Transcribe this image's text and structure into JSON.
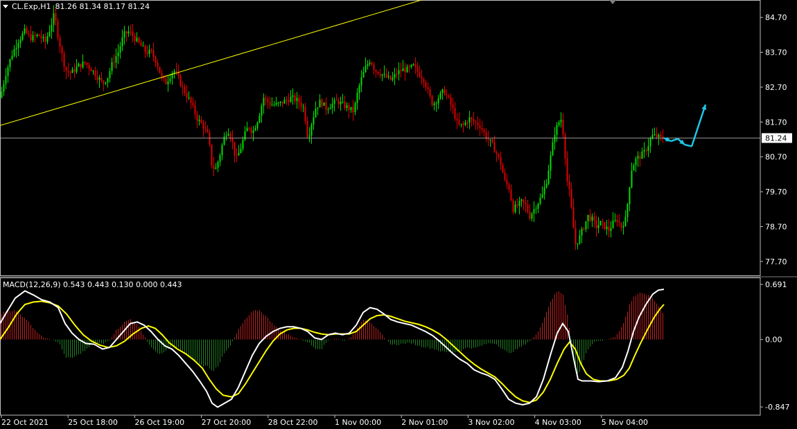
{
  "header": {
    "symbol": "CL.Exp,H1",
    "open": "81.26",
    "high": "81.34",
    "low": "81.17",
    "close": "81.24"
  },
  "macd_header": {
    "label": "MACD(12,26,9)",
    "values": "0.543 0.443 0.130 0.000 0.443"
  },
  "colors": {
    "background": "#000000",
    "bull": "#00e000",
    "bear": "#e00000",
    "trendline": "#ffff00",
    "price_line": "#c8c8c8",
    "forecast": "#1ec8e6",
    "macd_line": "#ffffff",
    "signal_line": "#ffff00",
    "hist_pos": "#c02020",
    "hist_neg": "#208020"
  },
  "chart_data": [
    {
      "type": "candlestick",
      "title": "CL.Exp,H1",
      "y_ticks": [
        "84.70",
        "83.70",
        "82.70",
        "81.70",
        "80.70",
        "79.70",
        "78.70",
        "77.70"
      ],
      "ylim": [
        77.3,
        85.2
      ],
      "current_price": "81.24",
      "x_ticks": [
        "22 Oct 2021",
        "25 Oct 18:00",
        "26 Oct 19:00",
        "27 Oct 20:00",
        "28 Oct 22:00",
        "1 Nov 00:00",
        "2 Nov 01:00",
        "3 Nov 02:00",
        "4 Nov 03:00",
        "5 Nov 04:00"
      ],
      "close_path": [
        [
          0,
          82.4
        ],
        [
          8,
          83.1
        ],
        [
          16,
          83.6
        ],
        [
          25,
          84.0
        ],
        [
          35,
          84.3
        ],
        [
          45,
          84.1
        ],
        [
          55,
          84.2
        ],
        [
          65,
          84.0
        ],
        [
          72,
          84.4
        ],
        [
          78,
          84.8
        ],
        [
          83,
          84.2
        ],
        [
          88,
          83.7
        ],
        [
          94,
          83.2
        ],
        [
          102,
          83.1
        ],
        [
          112,
          83.3
        ],
        [
          122,
          83.4
        ],
        [
          132,
          83.2
        ],
        [
          140,
          83.0
        ],
        [
          148,
          82.8
        ],
        [
          155,
          83.0
        ],
        [
          162,
          83.4
        ],
        [
          170,
          83.7
        ],
        [
          178,
          84.2
        ],
        [
          186,
          84.3
        ],
        [
          194,
          84.1
        ],
        [
          202,
          83.9
        ],
        [
          210,
          83.7
        ],
        [
          218,
          83.7
        ],
        [
          226,
          83.4
        ],
        [
          232,
          83.0
        ],
        [
          238,
          82.8
        ],
        [
          244,
          83.0
        ],
        [
          250,
          83.2
        ],
        [
          256,
          83.0
        ],
        [
          262,
          82.7
        ],
        [
          268,
          82.5
        ],
        [
          276,
          82.2
        ],
        [
          284,
          81.8
        ],
        [
          292,
          81.6
        ],
        [
          300,
          81.3
        ],
        [
          305,
          80.5
        ],
        [
          310,
          80.3
        ],
        [
          316,
          80.7
        ],
        [
          322,
          81.2
        ],
        [
          328,
          81.5
        ],
        [
          334,
          81.2
        ],
        [
          340,
          80.6
        ],
        [
          346,
          80.9
        ],
        [
          352,
          81.3
        ],
        [
          358,
          81.6
        ],
        [
          364,
          81.4
        ],
        [
          372,
          81.8
        ],
        [
          380,
          82.4
        ],
        [
          390,
          82.2
        ],
        [
          400,
          82.2
        ],
        [
          410,
          82.3
        ],
        [
          420,
          82.4
        ],
        [
          430,
          82.3
        ],
        [
          438,
          82.1
        ],
        [
          444,
          81.2
        ],
        [
          448,
          81.6
        ],
        [
          455,
          82.1
        ],
        [
          462,
          82.3
        ],
        [
          470,
          82.1
        ],
        [
          478,
          82.2
        ],
        [
          486,
          82.3
        ],
        [
          494,
          82.2
        ],
        [
          502,
          82.1
        ],
        [
          510,
          82.0
        ],
        [
          516,
          82.6
        ],
        [
          522,
          83.0
        ],
        [
          528,
          83.3
        ],
        [
          534,
          83.5
        ],
        [
          540,
          83.2
        ],
        [
          548,
          83.1
        ],
        [
          556,
          83.0
        ],
        [
          564,
          82.9
        ],
        [
          572,
          83.1
        ],
        [
          580,
          83.2
        ],
        [
          588,
          83.2
        ],
        [
          596,
          83.3
        ],
        [
          604,
          83.1
        ],
        [
          612,
          82.9
        ],
        [
          618,
          82.5
        ],
        [
          624,
          82.2
        ],
        [
          632,
          82.4
        ],
        [
          640,
          82.6
        ],
        [
          648,
          82.3
        ],
        [
          654,
          82.0
        ],
        [
          660,
          81.6
        ],
        [
          668,
          81.6
        ],
        [
          676,
          81.8
        ],
        [
          684,
          81.7
        ],
        [
          692,
          81.6
        ],
        [
          700,
          81.3
        ],
        [
          708,
          81.1
        ],
        [
          716,
          80.8
        ],
        [
          722,
          80.5
        ],
        [
          728,
          80.0
        ],
        [
          734,
          79.8
        ],
        [
          740,
          79.2
        ],
        [
          746,
          79.3
        ],
        [
          752,
          79.4
        ],
        [
          758,
          79.3
        ],
        [
          764,
          79.0
        ],
        [
          770,
          79.2
        ],
        [
          776,
          79.4
        ],
        [
          782,
          79.6
        ],
        [
          788,
          80.0
        ],
        [
          794,
          80.7
        ],
        [
          800,
          81.4
        ],
        [
          806,
          81.7
        ],
        [
          810,
          81.8
        ],
        [
          814,
          81.0
        ],
        [
          818,
          80.0
        ],
        [
          822,
          79.6
        ],
        [
          826,
          78.8
        ],
        [
          830,
          78.2
        ],
        [
          836,
          78.4
        ],
        [
          842,
          78.7
        ],
        [
          848,
          79.0
        ],
        [
          854,
          78.9
        ],
        [
          860,
          78.7
        ],
        [
          866,
          78.8
        ],
        [
          872,
          78.7
        ],
        [
          878,
          78.6
        ],
        [
          884,
          78.8
        ],
        [
          890,
          78.9
        ],
        [
          896,
          78.7
        ],
        [
          902,
          78.9
        ],
        [
          906,
          79.5
        ],
        [
          910,
          80.3
        ],
        [
          916,
          80.6
        ],
        [
          922,
          80.7
        ],
        [
          928,
          80.8
        ],
        [
          934,
          81.0
        ],
        [
          940,
          81.3
        ],
        [
          946,
          81.3
        ],
        [
          952,
          81.24
        ],
        [
          958,
          81.24
        ]
      ],
      "trendline": {
        "x": [
          0,
          620
        ],
        "y": [
          81.6,
          85.27
        ]
      },
      "forecast_path": [
        [
          958,
          81.24
        ],
        [
          968,
          81.15
        ],
        [
          978,
          81.22
        ],
        [
          988,
          81.05
        ],
        [
          998,
          81.0
        ],
        [
          1018,
          82.2
        ]
      ]
    },
    {
      "type": "macd",
      "title": "MACD(12,26,9)",
      "y_ticks": [
        "0.691",
        "0.00",
        "-0.847"
      ],
      "ylim": [
        -0.95,
        0.77
      ],
      "macd_path": [
        [
          0,
          0.2
        ],
        [
          10,
          0.35
        ],
        [
          22,
          0.52
        ],
        [
          36,
          0.61
        ],
        [
          48,
          0.56
        ],
        [
          60,
          0.5
        ],
        [
          72,
          0.47
        ],
        [
          84,
          0.4
        ],
        [
          94,
          0.2
        ],
        [
          104,
          0.08
        ],
        [
          114,
          0.0
        ],
        [
          124,
          -0.05
        ],
        [
          136,
          -0.06
        ],
        [
          148,
          -0.12
        ],
        [
          158,
          -0.1
        ],
        [
          168,
          0.0
        ],
        [
          178,
          0.1
        ],
        [
          188,
          0.2
        ],
        [
          198,
          0.22
        ],
        [
          208,
          0.18
        ],
        [
          218,
          0.1
        ],
        [
          228,
          0.0
        ],
        [
          238,
          -0.08
        ],
        [
          248,
          -0.12
        ],
        [
          258,
          -0.2
        ],
        [
          268,
          -0.3
        ],
        [
          278,
          -0.4
        ],
        [
          288,
          -0.52
        ],
        [
          298,
          -0.65
        ],
        [
          306,
          -0.8
        ],
        [
          314,
          -0.85
        ],
        [
          324,
          -0.8
        ],
        [
          334,
          -0.75
        ],
        [
          344,
          -0.6
        ],
        [
          354,
          -0.4
        ],
        [
          364,
          -0.2
        ],
        [
          374,
          -0.05
        ],
        [
          384,
          0.04
        ],
        [
          394,
          0.1
        ],
        [
          404,
          0.14
        ],
        [
          414,
          0.16
        ],
        [
          424,
          0.16
        ],
        [
          434,
          0.14
        ],
        [
          444,
          0.1
        ],
        [
          454,
          0.02
        ],
        [
          464,
          0.0
        ],
        [
          474,
          0.06
        ],
        [
          484,
          0.08
        ],
        [
          494,
          0.06
        ],
        [
          504,
          0.08
        ],
        [
          514,
          0.18
        ],
        [
          524,
          0.34
        ],
        [
          534,
          0.4
        ],
        [
          544,
          0.38
        ],
        [
          554,
          0.32
        ],
        [
          564,
          0.25
        ],
        [
          574,
          0.22
        ],
        [
          584,
          0.2
        ],
        [
          594,
          0.18
        ],
        [
          604,
          0.14
        ],
        [
          614,
          0.1
        ],
        [
          624,
          0.05
        ],
        [
          634,
          -0.02
        ],
        [
          644,
          -0.1
        ],
        [
          654,
          -0.18
        ],
        [
          664,
          -0.25
        ],
        [
          674,
          -0.3
        ],
        [
          684,
          -0.38
        ],
        [
          694,
          -0.42
        ],
        [
          704,
          -0.45
        ],
        [
          714,
          -0.5
        ],
        [
          724,
          -0.62
        ],
        [
          734,
          -0.75
        ],
        [
          744,
          -0.8
        ],
        [
          754,
          -0.82
        ],
        [
          764,
          -0.8
        ],
        [
          774,
          -0.72
        ],
        [
          784,
          -0.5
        ],
        [
          794,
          -0.2
        ],
        [
          804,
          0.08
        ],
        [
          812,
          0.2
        ],
        [
          820,
          0.1
        ],
        [
          828,
          -0.25
        ],
        [
          834,
          -0.5
        ],
        [
          840,
          -0.52
        ],
        [
          852,
          -0.52
        ],
        [
          864,
          -0.53
        ],
        [
          876,
          -0.52
        ],
        [
          888,
          -0.48
        ],
        [
          898,
          -0.35
        ],
        [
          906,
          -0.15
        ],
        [
          914,
          0.1
        ],
        [
          922,
          0.28
        ],
        [
          932,
          0.44
        ],
        [
          942,
          0.57
        ],
        [
          950,
          0.62
        ],
        [
          958,
          0.63
        ]
      ],
      "signal_path": [
        [
          0,
          0.0
        ],
        [
          12,
          0.15
        ],
        [
          24,
          0.32
        ],
        [
          36,
          0.44
        ],
        [
          48,
          0.47
        ],
        [
          60,
          0.48
        ],
        [
          72,
          0.46
        ],
        [
          84,
          0.42
        ],
        [
          96,
          0.32
        ],
        [
          108,
          0.18
        ],
        [
          120,
          0.06
        ],
        [
          132,
          -0.02
        ],
        [
          144,
          -0.07
        ],
        [
          156,
          -0.1
        ],
        [
          168,
          -0.08
        ],
        [
          180,
          -0.02
        ],
        [
          192,
          0.07
        ],
        [
          204,
          0.14
        ],
        [
          214,
          0.17
        ],
        [
          224,
          0.14
        ],
        [
          234,
          0.06
        ],
        [
          244,
          -0.04
        ],
        [
          256,
          -0.12
        ],
        [
          268,
          -0.18
        ],
        [
          280,
          -0.26
        ],
        [
          292,
          -0.36
        ],
        [
          302,
          -0.5
        ],
        [
          312,
          -0.62
        ],
        [
          322,
          -0.7
        ],
        [
          334,
          -0.72
        ],
        [
          344,
          -0.68
        ],
        [
          354,
          -0.56
        ],
        [
          364,
          -0.42
        ],
        [
          374,
          -0.28
        ],
        [
          384,
          -0.14
        ],
        [
          394,
          -0.02
        ],
        [
          404,
          0.07
        ],
        [
          414,
          0.12
        ],
        [
          424,
          0.14
        ],
        [
          434,
          0.14
        ],
        [
          444,
          0.12
        ],
        [
          454,
          0.09
        ],
        [
          464,
          0.07
        ],
        [
          474,
          0.06
        ],
        [
          484,
          0.07
        ],
        [
          494,
          0.07
        ],
        [
          504,
          0.07
        ],
        [
          514,
          0.1
        ],
        [
          524,
          0.18
        ],
        [
          534,
          0.26
        ],
        [
          544,
          0.3
        ],
        [
          554,
          0.31
        ],
        [
          564,
          0.29
        ],
        [
          574,
          0.26
        ],
        [
          584,
          0.23
        ],
        [
          594,
          0.21
        ],
        [
          604,
          0.19
        ],
        [
          614,
          0.16
        ],
        [
          624,
          0.12
        ],
        [
          634,
          0.07
        ],
        [
          644,
          0.0
        ],
        [
          654,
          -0.08
        ],
        [
          664,
          -0.16
        ],
        [
          674,
          -0.24
        ],
        [
          684,
          -0.31
        ],
        [
          694,
          -0.37
        ],
        [
          704,
          -0.42
        ],
        [
          714,
          -0.47
        ],
        [
          724,
          -0.55
        ],
        [
          734,
          -0.64
        ],
        [
          744,
          -0.72
        ],
        [
          754,
          -0.77
        ],
        [
          764,
          -0.79
        ],
        [
          774,
          -0.76
        ],
        [
          784,
          -0.66
        ],
        [
          794,
          -0.5
        ],
        [
          804,
          -0.3
        ],
        [
          814,
          -0.12
        ],
        [
          822,
          -0.03
        ],
        [
          830,
          -0.12
        ],
        [
          838,
          -0.3
        ],
        [
          846,
          -0.43
        ],
        [
          856,
          -0.5
        ],
        [
          866,
          -0.52
        ],
        [
          878,
          -0.52
        ],
        [
          890,
          -0.5
        ],
        [
          900,
          -0.45
        ],
        [
          908,
          -0.36
        ],
        [
          916,
          -0.2
        ],
        [
          924,
          -0.05
        ],
        [
          934,
          0.12
        ],
        [
          944,
          0.28
        ],
        [
          952,
          0.38
        ],
        [
          958,
          0.44
        ]
      ]
    }
  ]
}
